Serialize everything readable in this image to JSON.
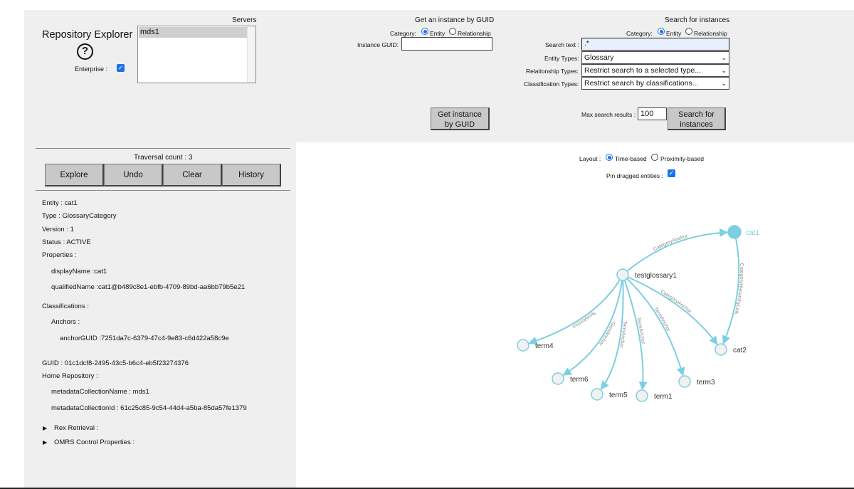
{
  "app": {
    "title": "Repository Explorer",
    "enterprise_label": "Enterprise :"
  },
  "servers": {
    "header": "Servers",
    "items": [
      "mds1"
    ]
  },
  "get_instance": {
    "header": "Get an instance by GUID",
    "category_label": "Category:",
    "entity_label": "Entity",
    "relationship_label": "Relationship",
    "guid_label": "Instance GUID:",
    "guid_value": "",
    "button_line1": "Get instance",
    "button_line2": "by GUID"
  },
  "search": {
    "header": "Search for instances",
    "category_label": "Category:",
    "entity_label": "Entity",
    "relationship_label": "Relationship",
    "text_label": "Search text :",
    "text_value": ".*",
    "entity_types_label": "Entity Types:",
    "entity_types_value": "Glossary",
    "relationship_types_label": "Relationship Types:",
    "relationship_types_value": "Restrict search to a selected type...",
    "classification_types_label": "Classification Types:",
    "classification_types_value": "Restrict search by classifications...",
    "max_results_label": "Max search results :",
    "max_results_value": "100",
    "button_line1": "Search for",
    "button_line2": "instances"
  },
  "traversal": {
    "count_label": "Traversal count : 3",
    "buttons": [
      "Explore",
      "Undo",
      "Clear",
      "History"
    ]
  },
  "details": {
    "entity": "Entity : cat1",
    "type": "Type : GlossaryCategory",
    "version": "Version : 1",
    "status": "Status : ACTIVE",
    "properties_label": "Properties :",
    "display_name": "displayName :cat1",
    "qualified_name": "qualifiedName :cat1@b489c8e1-ebfb-4709-89bd-aa6bb79b5e21",
    "classifications_label": "Classifications :",
    "anchors_label": "Anchors :",
    "anchor_guid": "anchorGUID :7251da7c-6379-47c4-9e83-c6d422a58c9e",
    "guid": "GUID : 01c1dcf8-2495-43c5-b6c4-eb5f23274376",
    "home_repo_label": "Home Repository :",
    "metadata_collection_name": "metadataCollectionName : mds1",
    "metadata_collection_id": "metadataCollectionId : 61c25c85-9c54-44d4-a5ba-85da57fe1379",
    "rex_retrieval": "Rex Retrieval :",
    "omrs_control": "OMRS Control Properties :"
  },
  "layout_controls": {
    "layout_label": "Layout :",
    "time_based": "Time-based",
    "proximity_based": "Proximity-based",
    "pin_label": "Pin dragged entities :"
  },
  "graph": {
    "node_color": "#7ccfe0",
    "edge_color": "#7ccfe0",
    "nodes": [
      {
        "id": "cat1",
        "label": "cat1",
        "selected": true
      },
      {
        "id": "testglossary1",
        "label": "testglossary1"
      },
      {
        "id": "cat2",
        "label": "cat2"
      },
      {
        "id": "term4",
        "label": "term4"
      },
      {
        "id": "term6",
        "label": "term6"
      },
      {
        "id": "term5",
        "label": "term5"
      },
      {
        "id": "term1",
        "label": "term1"
      },
      {
        "id": "term3",
        "label": "term3"
      }
    ],
    "edges": [
      {
        "from": "testglossary1",
        "to": "cat1",
        "label": "CategoryAnchor"
      },
      {
        "from": "testglossary1",
        "to": "cat2",
        "label": "CategoryAnchor"
      },
      {
        "from": "cat1",
        "to": "cat2",
        "label": "CategoryHierarchyLink"
      },
      {
        "from": "testglossary1",
        "to": "term4",
        "label": "TermAnchor"
      },
      {
        "from": "testglossary1",
        "to": "term6",
        "label": "TermAnchor"
      },
      {
        "from": "testglossary1",
        "to": "term5",
        "label": "TermAnchor"
      },
      {
        "from": "testglossary1",
        "to": "term1",
        "label": "TermAnchor"
      },
      {
        "from": "testglossary1",
        "to": "term3",
        "label": "TermAnchor"
      }
    ]
  }
}
